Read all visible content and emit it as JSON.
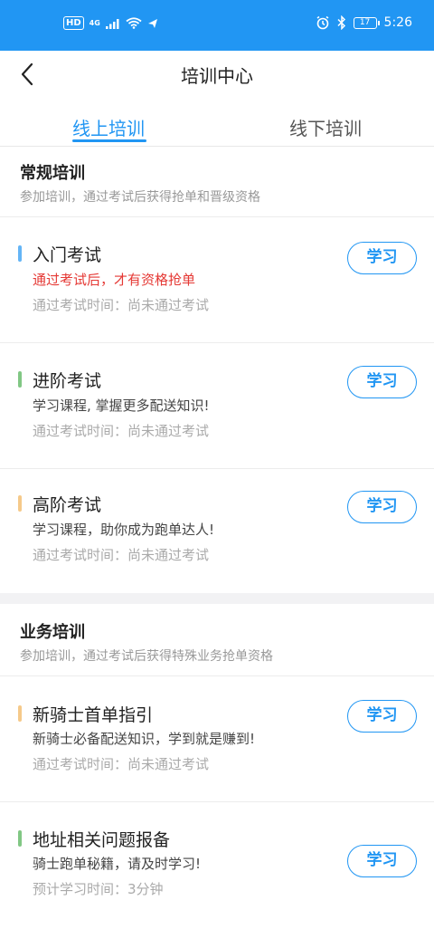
{
  "status_bar": {
    "hd": "HD",
    "network": "4G",
    "battery": "17",
    "time": "5:26"
  },
  "header": {
    "title": "培训中心"
  },
  "tabs": [
    {
      "label": "线上培训",
      "active": true
    },
    {
      "label": "线下培训",
      "active": false
    }
  ],
  "regular": {
    "title": "常规培训",
    "subtitle": "参加培训，通过考试后获得抢单和晋级资格",
    "items": [
      {
        "name": "入门考试",
        "desc": "通过考试后，才有资格抢单",
        "time_label": "通过考试时间：",
        "time_value": "尚未通过考试",
        "button": "学习",
        "bar_color": "#64b5f6"
      },
      {
        "name": "进阶考试",
        "desc": "学习课程, 掌握更多配送知识!",
        "time_label": "通过考试时间：",
        "time_value": "尚未通过考试",
        "button": "学习",
        "bar_color": "#81c784"
      },
      {
        "name": "高阶考试",
        "desc": "学习课程，助你成为跑单达人!",
        "time_label": "通过考试时间：",
        "time_value": "尚未通过考试",
        "button": "学习",
        "bar_color": "#f5c98a"
      }
    ]
  },
  "business": {
    "title": "业务培训",
    "subtitle": "参加培训，通过考试后获得特殊业务抢单资格",
    "items": [
      {
        "name": "新骑士首单指引",
        "desc": "新骑士必备配送知识，学到就是赚到!",
        "time_label": "通过考试时间：",
        "time_value": "尚未通过考试",
        "button": "学习",
        "bar_color": "#f5c98a"
      },
      {
        "name": "地址相关问题报备",
        "desc": "骑士跑单秘籍，请及时学习!",
        "time_label": "预计学习时间：",
        "time_value": "3分钟",
        "button": "学习",
        "bar_color": "#81c784"
      }
    ]
  },
  "colors": {
    "accent": "#2196f3",
    "warning_text": "#e53935"
  }
}
